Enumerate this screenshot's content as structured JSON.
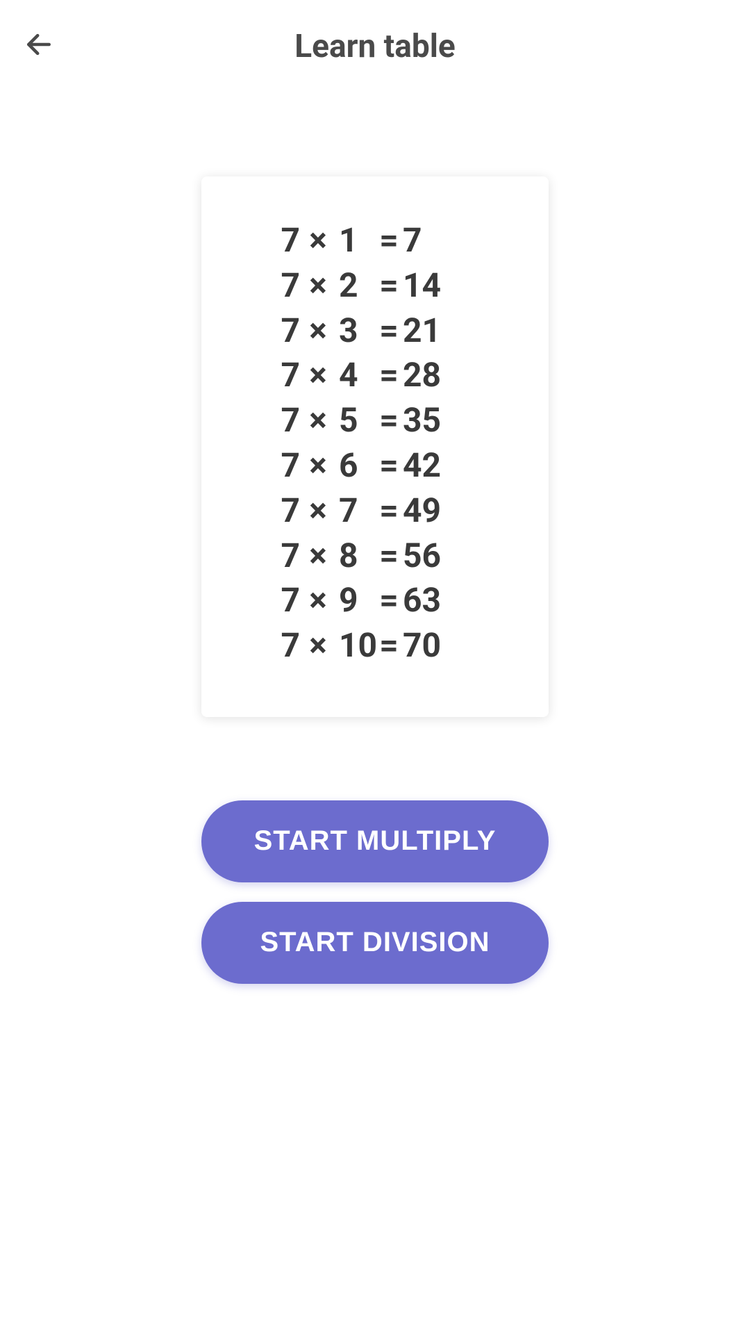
{
  "header": {
    "title": "Learn table"
  },
  "table": {
    "operator": "×",
    "equals": "=",
    "rows": [
      {
        "a": "7",
        "b": "1",
        "result": "7"
      },
      {
        "a": "7",
        "b": "2",
        "result": "14"
      },
      {
        "a": "7",
        "b": "3",
        "result": "21"
      },
      {
        "a": "7",
        "b": "4",
        "result": "28"
      },
      {
        "a": "7",
        "b": "5",
        "result": "35"
      },
      {
        "a": "7",
        "b": "6",
        "result": "42"
      },
      {
        "a": "7",
        "b": "7",
        "result": "49"
      },
      {
        "a": "7",
        "b": "8",
        "result": "56"
      },
      {
        "a": "7",
        "b": "9",
        "result": "63"
      },
      {
        "a": "7",
        "b": "10",
        "result": "70"
      }
    ]
  },
  "buttons": {
    "multiply": "START MULTIPLY",
    "division": "START DIVISION"
  }
}
